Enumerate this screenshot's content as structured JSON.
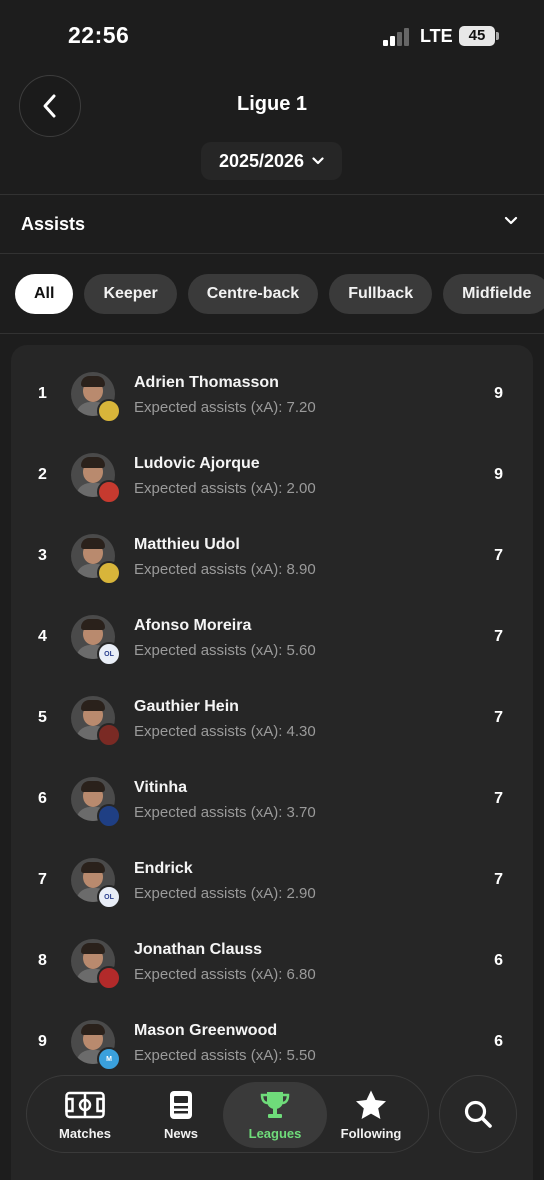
{
  "status_bar": {
    "time": "22:56",
    "network": "LTE",
    "battery": "45"
  },
  "header": {
    "title": "Ligue 1",
    "season": "2025/2026"
  },
  "stat": {
    "label": "Assists"
  },
  "filters": [
    "All",
    "Keeper",
    "Centre-back",
    "Fullback",
    "Midfielde"
  ],
  "players": [
    {
      "rank": "1",
      "name": "Adrien Thomasson",
      "sub": "Expected assists (xA): 7.20",
      "value": "9",
      "club_color": "#d8b53a"
    },
    {
      "rank": "2",
      "name": "Ludovic Ajorque",
      "sub": "Expected assists (xA): 2.00",
      "value": "9",
      "club_color": "#c63a2f"
    },
    {
      "rank": "3",
      "name": "Matthieu Udol",
      "sub": "Expected assists (xA): 8.90",
      "value": "7",
      "club_color": "#d8b53a"
    },
    {
      "rank": "4",
      "name": "Afonso Moreira",
      "sub": "Expected assists (xA): 5.60",
      "value": "7",
      "club_color": "#e9eef7",
      "club_text": "OL"
    },
    {
      "rank": "5",
      "name": "Gauthier Hein",
      "sub": "Expected assists (xA): 4.30",
      "value": "7",
      "club_color": "#7a2a24"
    },
    {
      "rank": "6",
      "name": "Vitinha",
      "sub": "Expected assists (xA): 3.70",
      "value": "7",
      "club_color": "#1f3f84"
    },
    {
      "rank": "7",
      "name": "Endrick",
      "sub": "Expected assists (xA): 2.90",
      "value": "7",
      "club_color": "#e9eef7",
      "club_text": "OL"
    },
    {
      "rank": "8",
      "name": "Jonathan Clauss",
      "sub": "Expected assists (xA): 6.80",
      "value": "6",
      "club_color": "#b22a2a"
    },
    {
      "rank": "9",
      "name": "Mason Greenwood",
      "sub": "Expected assists (xA): 5.50",
      "value": "6",
      "club_color": "#3aa0dc",
      "club_text": "M"
    }
  ],
  "nav": {
    "items": [
      {
        "label": "Matches",
        "icon": "matches-icon"
      },
      {
        "label": "News",
        "icon": "news-icon"
      },
      {
        "label": "Leagues",
        "icon": "trophy-icon",
        "active": true
      },
      {
        "label": "Following",
        "icon": "star-icon"
      }
    ],
    "accent": "#6fdc7a"
  }
}
